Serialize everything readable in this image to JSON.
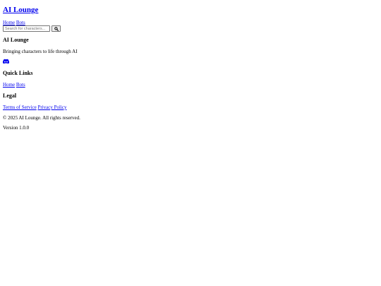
{
  "header": {
    "site_title": "AI Lounge",
    "nav": {
      "home": "Home",
      "bots": "Bots"
    },
    "search": {
      "placeholder": "Search for characters...",
      "value": "",
      "icon": "search-icon"
    }
  },
  "footer": {
    "brand": {
      "title": "AI Lounge",
      "tagline": "Bringing characters to life through AI",
      "social_icon": "discord-icon"
    },
    "quick_links": {
      "heading": "Quick Links",
      "home": "Home",
      "bots": "Bots"
    },
    "legal": {
      "heading": "Legal",
      "terms": "Terms of Service",
      "privacy": "Privacy Policy"
    },
    "copyright": "© 2025 AI Lounge. All rights reserved.",
    "version": "Version 1.0.0"
  },
  "colors": {
    "link": "#0000ee",
    "text": "#000000",
    "background": "#ffffff"
  }
}
